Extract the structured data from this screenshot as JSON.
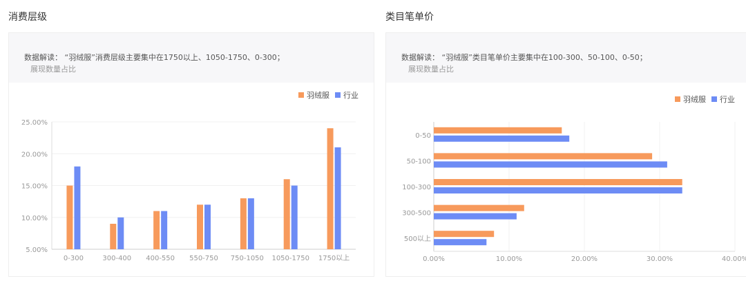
{
  "colors": {
    "brand": "#f79a5c",
    "industry": "#6d8cf5"
  },
  "chart_data": [
    {
      "type": "bar",
      "title": "消费层级",
      "note": "数据解读：    “羽绒服”消费层级主要集中在1750以上、1050-1750、0-300；",
      "ylabel": "展现数量占比",
      "categories": [
        "0-300",
        "300-400",
        "400-550",
        "550-750",
        "750-1050",
        "1050-1750",
        "1750以上"
      ],
      "series": [
        {
          "name": "羽绒服",
          "values": [
            15,
            9,
            11,
            12,
            13,
            16,
            24
          ]
        },
        {
          "name": "行业",
          "values": [
            18,
            10,
            11,
            12,
            13,
            15,
            21
          ]
        }
      ],
      "ylim": [
        5,
        25
      ],
      "yticks": [
        "5.00%",
        "10.00%",
        "15.00%",
        "20.00%",
        "25.00%"
      ],
      "legend": "top-right"
    },
    {
      "type": "bar-horizontal",
      "title": "类目笔单价",
      "note": "数据解读：    “羽绒服”类目笔单价主要集中在100-300、50-100、0-50；",
      "ylabel": "展现数量占比",
      "categories": [
        "0-50",
        "50-100",
        "100-300",
        "300-500",
        "500以上"
      ],
      "series": [
        {
          "name": "羽绒服",
          "values": [
            17,
            29,
            33,
            12,
            8
          ]
        },
        {
          "name": "行业",
          "values": [
            18,
            31,
            33,
            11,
            7
          ]
        }
      ],
      "xlim": [
        0,
        40
      ],
      "xticks": [
        "0.00%",
        "10.00%",
        "20.00%",
        "30.00%",
        "40.00%"
      ],
      "legend": "top-right"
    }
  ]
}
